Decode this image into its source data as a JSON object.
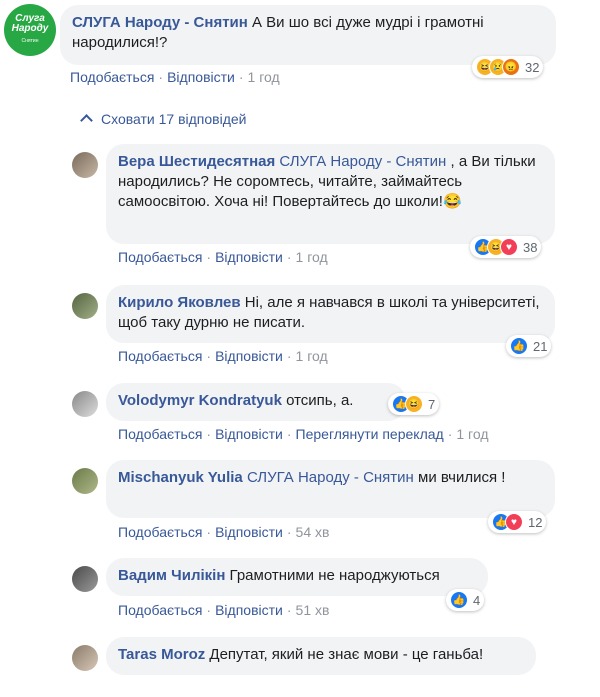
{
  "comment": {
    "avatar_text": [
      "Слуга",
      "Народу",
      "Снятин"
    ],
    "author": "СЛУГА Народу - Снятин",
    "text": "А Ви шо всі дуже мудрі і грамотні народилися!?",
    "like": "Подобається",
    "reply": "Відповісти",
    "time": "1 год",
    "reaction_count": "32"
  },
  "hide_replies": "Сховати 17 відповідей",
  "replies": [
    {
      "author": "Вера Шестидесятная",
      "tag": "СЛУГА Народу - Снятин",
      "text": ", а Ви тільки народились? Не соромтесь, читайте, займайтесь самоосвітою. Хоча ні! Повертайтесь до школи!😂",
      "like": "Подобається",
      "reply": "Відповісти",
      "time": "1 год",
      "reaction_count": "38"
    },
    {
      "author": "Кирило Яковлев",
      "text": "Ні, але я навчався в школі та університеті, щоб таку дурню не писати.",
      "like": "Подобається",
      "reply": "Відповісти",
      "time": "1 год",
      "reaction_count": "21"
    },
    {
      "author": "Volodymyr Kondratyuk",
      "text": "отсипь, а.",
      "like": "Подобається",
      "reply": "Відповісти",
      "translate": "Переглянути переклад",
      "time": "1 год",
      "reaction_count": "7"
    },
    {
      "author": "Mischanyuk Yulia",
      "tag": "СЛУГА Народу - Снятин",
      "text": "ми вчилися !",
      "like": "Подобається",
      "reply": "Відповісти",
      "time": "54 хв",
      "reaction_count": "12"
    },
    {
      "author": "Вадим Чилікін",
      "text": "Грамотними не народжуються",
      "like": "Подобається",
      "reply": "Відповісти",
      "time": "51 хв",
      "reaction_count": "4"
    },
    {
      "author": "Taras Moroz",
      "text": "Депутат, який не знає мови - це ганьба!"
    }
  ],
  "colors": {
    "link": "#385898",
    "bubble": "#f2f3f5",
    "meta": "#90949c",
    "brand_avatar": "#27a844"
  },
  "icons": {
    "like": "thumbs-up-icon",
    "haha": "laughing-face-icon",
    "sad": "crying-face-icon",
    "angry": "angry-face-icon",
    "love": "heart-icon",
    "hide": "chevron-up-icon"
  }
}
